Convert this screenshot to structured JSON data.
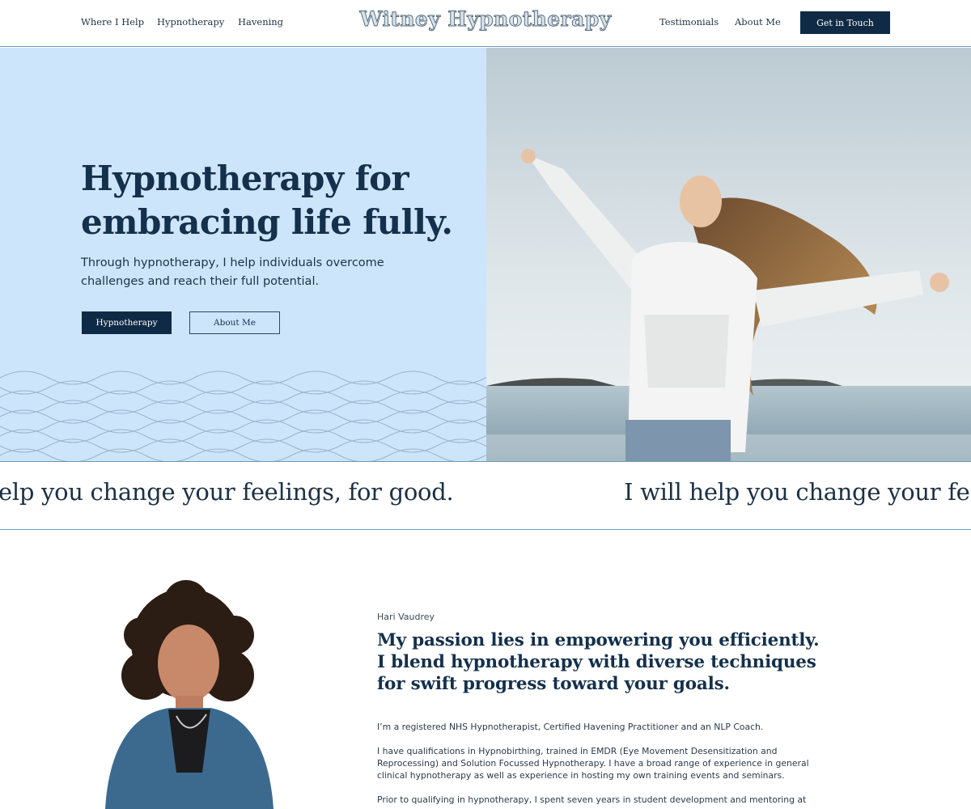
{
  "header": {
    "nav_left": [
      "Where I Help",
      "Hypnotherapy",
      "Havening"
    ],
    "logo": "Witney Hypnotherapy",
    "nav_right": [
      "Testimonials",
      "About Me"
    ],
    "cta": "Get in Touch"
  },
  "hero": {
    "title": "Hypnotherapy for embracing life fully.",
    "subtitle": "Through hypnotherapy, I help individuals overcome challenges and reach their full potential.",
    "primary_button": "Hypnotherapy",
    "secondary_button": "About Me"
  },
  "marquee": {
    "segment_1": "elp you change your feelings, for good.",
    "segment_2": "I will help you change your fee"
  },
  "about": {
    "name": "Hari Vaudrey",
    "heading": "My passion lies in empowering you efficiently. I blend hypnotherapy with diverse techniques for swift progress toward your goals.",
    "paragraphs": [
      "I’m a registered NHS Hypnotherapist, Certified Havening Practitioner and an NLP Coach.",
      "I have qualifications in Hypnobirthing, trained in EMDR (Eye Movement Desensitization and Reprocessing) and Solution Focussed Hypnotherapy.  I have a broad range of experience in general clinical hypnotherapy as well as experience in hosting my own training events and seminars.",
      "Prior to qualifying in hypnotherapy, I spent seven years in student development and mentoring at"
    ]
  },
  "colors": {
    "navy": "#0f2a44",
    "hero_blue": "#cde5fb",
    "divider": "#6f98b3"
  }
}
